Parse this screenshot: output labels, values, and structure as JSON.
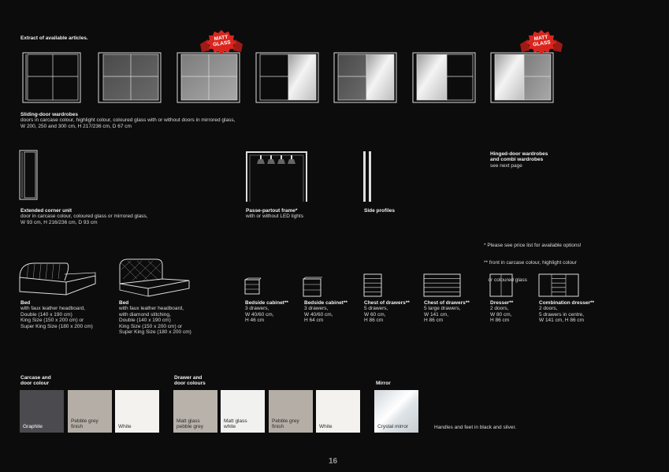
{
  "intro": "Extract of available articles.",
  "badge_text": [
    "MATT",
    "GLASS"
  ],
  "wardrobes": {
    "title": "Sliding-door wardrobes",
    "lines": [
      "doors in carcase colour, highlight colour, coloured glass with or without doors in mirrored glass,",
      "W 200, 250 and 300 cm, H 217/236 cm, D 67 cm"
    ]
  },
  "corner_unit": {
    "title": "Extended corner unit",
    "lines": [
      "door in carcase colour, coloured glass or mirrored glass,",
      "W 93 cm, H 216/236 cm, D 93 cm"
    ]
  },
  "passe_partout": {
    "title": "Passe-partout frame*",
    "lines": [
      "with or without LED lights"
    ]
  },
  "side_profiles": {
    "title": "Side profiles"
  },
  "hinged": {
    "lines": [
      "Hinged-door wardrobes",
      "and combi wardrobes",
      "see next page"
    ]
  },
  "notes": {
    "lines": [
      "* Please see price list for available options!",
      "** front in carcase colour, highlight colour",
      "   or coloured glass"
    ]
  },
  "beds": [
    {
      "title": "Bed",
      "lines": [
        "with faux leather headboard,",
        "Double (140 x 190 cm)",
        "King Size (150 x 200 cm) or",
        "Super King Size (180 x 200 cm)"
      ]
    },
    {
      "title": "Bed",
      "lines": [
        "with faux leather headboard,",
        "with diamond stitching,",
        "Double (140 x 190 cm)",
        "King Size (150 x 200 cm) or",
        "Super King Size (180 x 200 cm)"
      ]
    }
  ],
  "storage": [
    {
      "title": "Bedside cabinet**",
      "lines": [
        "3 drawers,",
        "W 40/60 cm,",
        "H 46 cm"
      ]
    },
    {
      "title": "Bedside cabinet**",
      "lines": [
        "3 drawers,",
        "W 40/60 cm,",
        "H 64 cm"
      ]
    },
    {
      "title": "Chest of drawers**",
      "lines": [
        "5 drawers,",
        "W 60 cm,",
        "H 86 cm"
      ]
    },
    {
      "title": "Chest of drawers**",
      "lines": [
        "5 large drawers,",
        "W 141 cm,",
        "H 86 cm"
      ]
    },
    {
      "title": "Dresser**",
      "lines": [
        "2 doors,",
        "W 80 cm,",
        "H 86 cm"
      ]
    },
    {
      "title": "Combination dresser**",
      "lines": [
        "2 doors,",
        "5 drawers in centre,",
        "W 141 cm, H 86 cm"
      ]
    }
  ],
  "colour_groups": {
    "carcase": [
      "Carcase and",
      "door colour"
    ],
    "drawer": [
      "Drawer and",
      "door colours"
    ],
    "mirror": "Mirror"
  },
  "swatches": [
    {
      "label": [
        "Graphite"
      ],
      "color": "#4a4a4f",
      "text_color": "#ffffff"
    },
    {
      "label": [
        "Pebble grey",
        "finish"
      ],
      "color": "#b4aea6",
      "text_color": "#2b2b2b"
    },
    {
      "label": [
        "White"
      ],
      "color": "#f3f2ee",
      "text_color": "#2b2b2b"
    },
    {
      "label": [
        "Matt glass",
        "pebble grey"
      ],
      "color": "#b8b2aa",
      "text_color": "#2b2b2b"
    },
    {
      "label": [
        "Matt glass",
        "white"
      ],
      "color": "#f1f1ef",
      "text_color": "#2b2b2b"
    },
    {
      "label": [
        "Pebble grey",
        "finish"
      ],
      "color": "#b4aea6",
      "text_color": "#2b2b2b"
    },
    {
      "label": [
        "White"
      ],
      "color": "#f3f2ee",
      "text_color": "#2b2b2b"
    },
    {
      "label": [
        "Crystal mirror"
      ],
      "color": "#e8ecef",
      "text_color": "#2b2b2b"
    }
  ],
  "handles_note": "Handles and feet in black and silver.",
  "page_number": "16",
  "colors": {
    "background": "#0c0c0c",
    "badge_red": "#d8261f"
  }
}
